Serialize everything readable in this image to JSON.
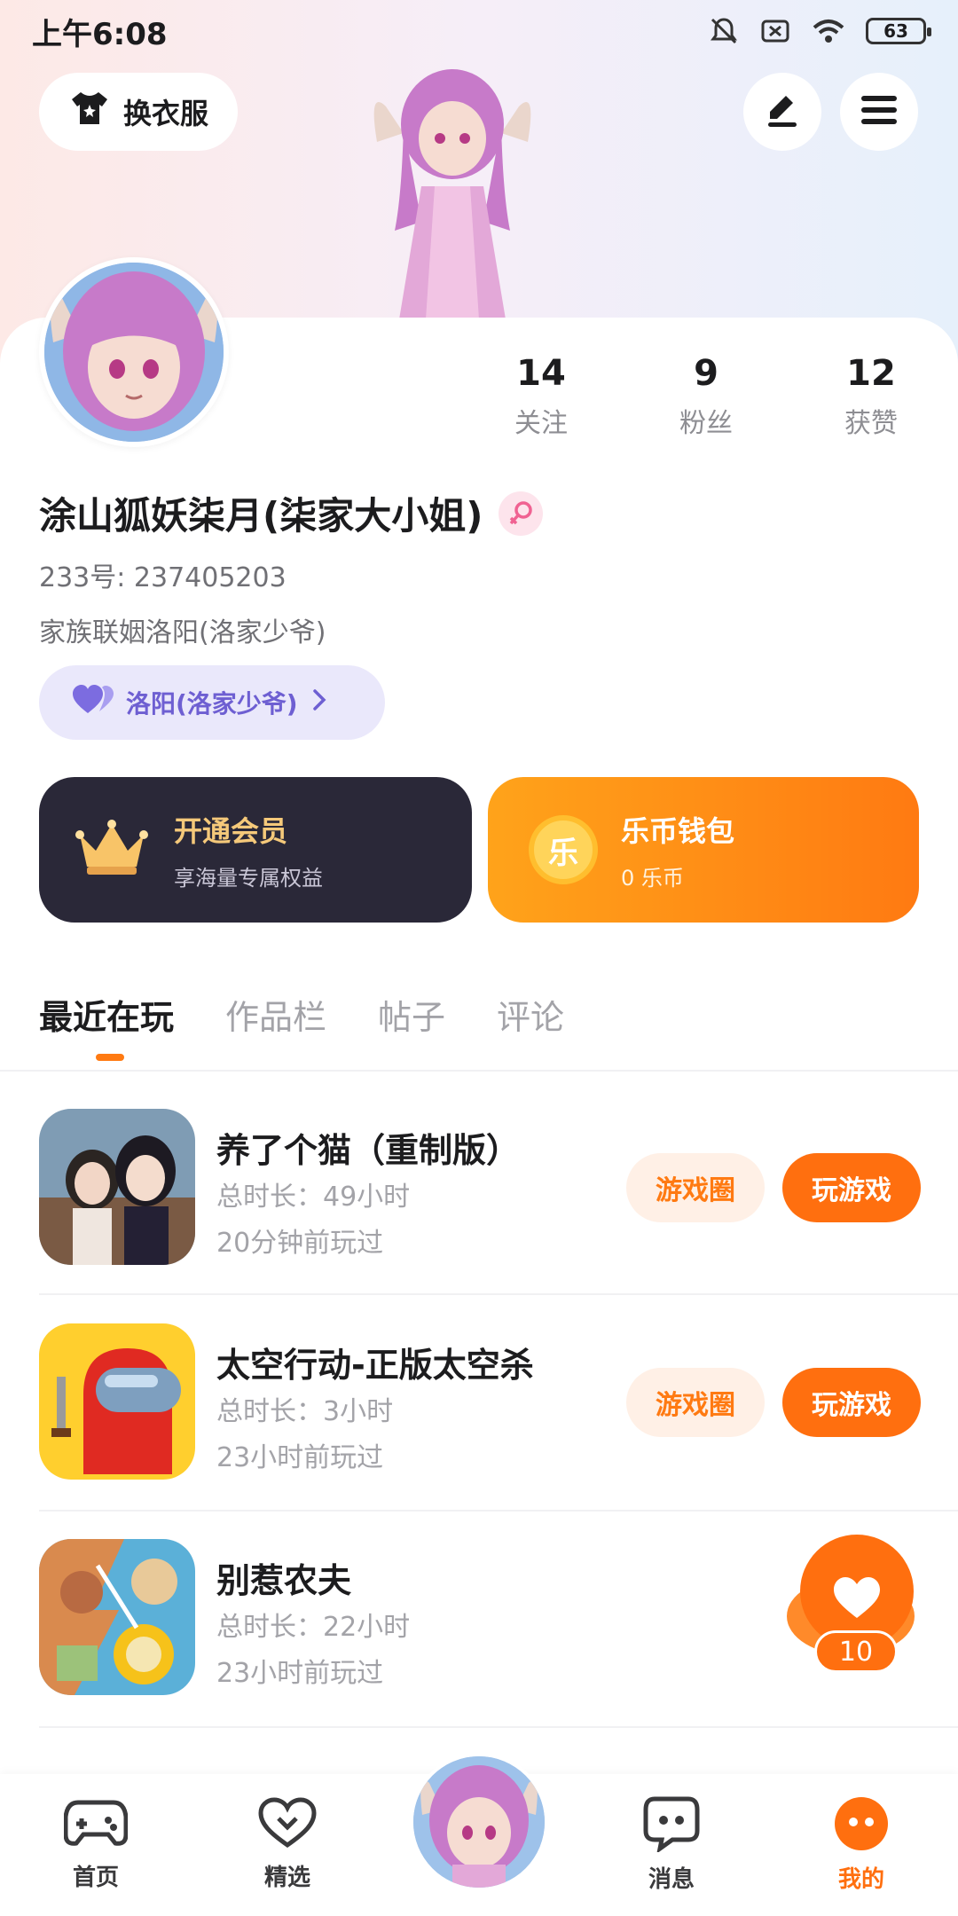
{
  "status_bar": {
    "time": "上午6:08",
    "battery": "63"
  },
  "header": {
    "dress_label": "换衣服"
  },
  "profile": {
    "stats": [
      {
        "count": "14",
        "label": "关注"
      },
      {
        "count": "9",
        "label": "粉丝"
      },
      {
        "count": "12",
        "label": "获赞"
      }
    ],
    "nickname": "涂山狐妖柒月(柒家大小姐)",
    "user_id": "233号: 237405203",
    "family": "家族联姻洛阳(洛家少爷)",
    "partner_label": "洛阳(洛家少爷)"
  },
  "cards": {
    "vip": {
      "title": "开通会员",
      "subtitle": "享海量专属权益"
    },
    "wallet": {
      "title": "乐币钱包",
      "subtitle": "0 乐币",
      "coin_glyph": "乐"
    }
  },
  "tabs": [
    {
      "label": "最近在玩",
      "active": true
    },
    {
      "label": "作品栏",
      "active": false
    },
    {
      "label": "帖子",
      "active": false
    },
    {
      "label": "评论",
      "active": false
    }
  ],
  "games": [
    {
      "name": "养了个猫（重制版）",
      "duration": "总时长：49小时",
      "last_played": "20分钟前玩过",
      "circle_label": "游戏圈",
      "play_label": "玩游戏"
    },
    {
      "name": "太空行动-正版太空杀",
      "duration": "总时长：3小时",
      "last_played": "23小时前玩过",
      "circle_label": "游戏圈",
      "play_label": "玩游戏"
    },
    {
      "name": "别惹农夫",
      "duration": "总时长：22小时",
      "last_played": "23小时前玩过"
    }
  ],
  "like_fab": {
    "count": "10"
  },
  "bottom_nav": [
    {
      "label": "首页",
      "icon": "gamepad-icon"
    },
    {
      "label": "精选",
      "icon": "heart-outline-icon"
    },
    {
      "label": "消息",
      "icon": "chat-bubble-icon"
    },
    {
      "label": "我的",
      "icon": "smile-face-icon",
      "active": true
    }
  ],
  "colors": {
    "accent": "#ff6f0f",
    "vip_bg": "#2a2838",
    "partner": "#6e5fd2"
  }
}
